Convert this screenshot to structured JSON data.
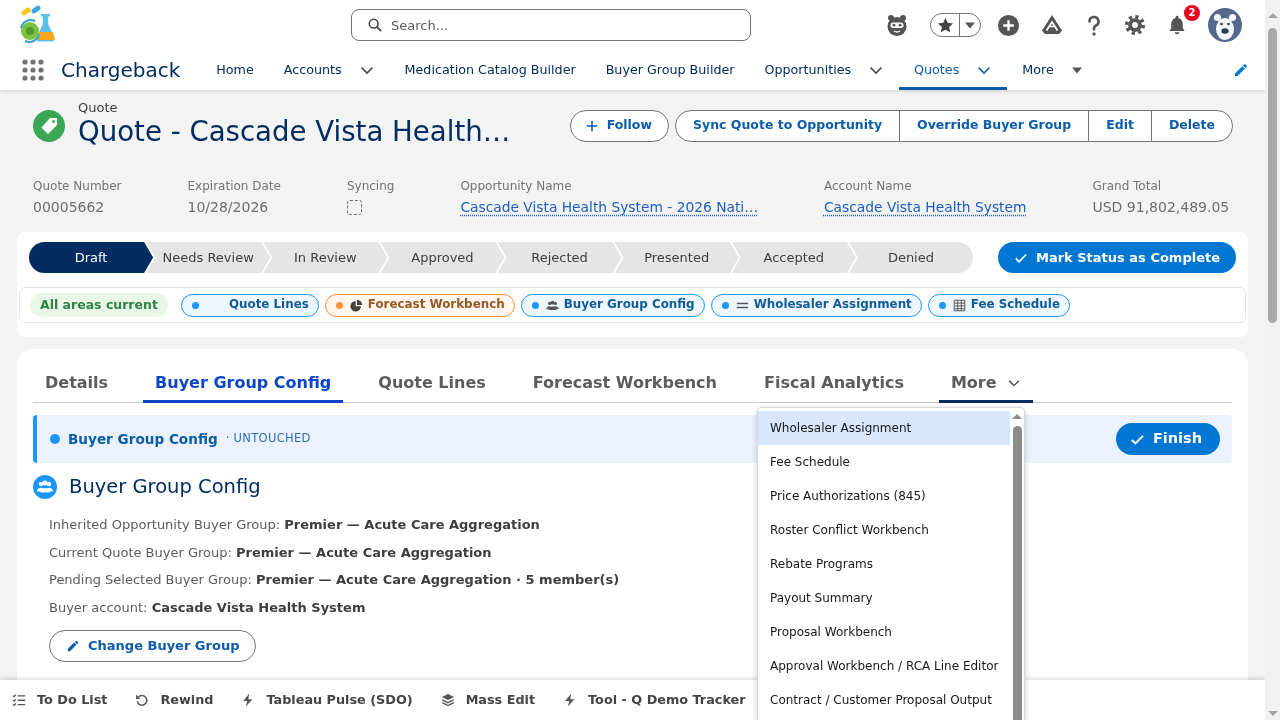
{
  "header": {
    "search": {
      "placeholder": "Search..."
    },
    "notification_count": "2"
  },
  "nav": {
    "app_name": "Chargeback",
    "items": [
      {
        "label": "Home",
        "kind": "link",
        "selected": false
      },
      {
        "label": "Accounts",
        "kind": "dropdown",
        "selected": false
      },
      {
        "label": "Medication Catalog Builder",
        "kind": "link",
        "selected": false
      },
      {
        "label": "Buyer Group Builder",
        "kind": "link",
        "selected": false
      },
      {
        "label": "Opportunities",
        "kind": "dropdown",
        "selected": false
      },
      {
        "label": "Quotes",
        "kind": "dropdown",
        "selected": true
      },
      {
        "label": "More",
        "kind": "overflow",
        "selected": false
      }
    ]
  },
  "record": {
    "object_label": "Quote",
    "title": "Quote - Cascade Vista Health…",
    "follow_button": "Follow",
    "actions": [
      "Sync Quote to Opportunity",
      "Override Buyer Group",
      "Edit",
      "Delete"
    ],
    "fields": [
      {
        "label": "Quote Number",
        "kind": "text",
        "value": "00005662"
      },
      {
        "label": "Expiration Date",
        "kind": "text",
        "value": "10/28/2026"
      },
      {
        "label": "Syncing",
        "kind": "checkbox",
        "checked": false
      },
      {
        "label": "Opportunity Name",
        "kind": "link",
        "value": "Cascade Vista Health System - 2026 Nati…"
      },
      {
        "label": "Account Name",
        "kind": "link",
        "value": "Cascade Vista Health System"
      },
      {
        "label": "Grand Total",
        "kind": "text",
        "value": "USD 91,802,489.05"
      }
    ]
  },
  "path": {
    "stages": [
      {
        "label": "Draft",
        "selected": true
      },
      {
        "label": "Needs Review",
        "selected": false
      },
      {
        "label": "In Review",
        "selected": false
      },
      {
        "label": "Approved",
        "selected": false
      },
      {
        "label": "Rejected",
        "selected": false
      },
      {
        "label": "Presented",
        "selected": false
      },
      {
        "label": "Accepted",
        "selected": false
      },
      {
        "label": "Denied",
        "selected": false
      }
    ],
    "complete_button": "Mark Status as Complete"
  },
  "areas": {
    "summary": "All areas current",
    "chips": [
      {
        "label": "Quote Lines",
        "kind": "plain",
        "color": "#1b96ff"
      },
      {
        "label": "Forecast Workbench",
        "kind": "chart",
        "color": "#fe9339"
      },
      {
        "label": "Buyer Group Config",
        "kind": "group",
        "color": "#1b96ff"
      },
      {
        "label": "Wholesaler Assignment",
        "kind": "list",
        "color": "#1b96ff"
      },
      {
        "label": "Fee Schedule",
        "kind": "table",
        "color": "#1b96ff"
      }
    ]
  },
  "tabs": {
    "items": [
      {
        "label": "Details",
        "selected": false
      },
      {
        "label": "Buyer Group Config",
        "selected": true
      },
      {
        "label": "Quote Lines",
        "selected": false
      },
      {
        "label": "Forecast Workbench",
        "selected": false
      },
      {
        "label": "Fiscal Analytics",
        "selected": false
      }
    ],
    "more": {
      "label": "More",
      "expanded": true
    }
  },
  "more_menu": {
    "items": [
      {
        "label": "Wholesaler Assignment",
        "selected": true
      },
      {
        "label": "Fee Schedule",
        "selected": false
      },
      {
        "label": "Price Authorizations (845)",
        "selected": false
      },
      {
        "label": "Roster Conflict Workbench",
        "selected": false
      },
      {
        "label": "Rebate Programs",
        "selected": false
      },
      {
        "label": "Payout Summary",
        "selected": false
      },
      {
        "label": "Proposal Workbench",
        "selected": false
      },
      {
        "label": "Approval Workbench / RCA Line Editor",
        "selected": false
      },
      {
        "label": "Contract / Customer Proposal Output",
        "selected": false
      }
    ]
  },
  "banner": {
    "title": "Buyer Group Config",
    "status": "· UNTOUCHED",
    "finish_button": "Finish"
  },
  "section": {
    "title": "Buyer Group Config",
    "lines": [
      "Inherited Opportunity Buyer Group: **Premier — Acute Care Aggregation**",
      "Current Quote Buyer Group: **Premier — Acute Care Aggregation**",
      "Pending Selected Buyer Group: **Premier — Acute Care Aggregation · 5 member(s)**",
      "Buyer account: **Cascade Vista Health System**"
    ],
    "change_button": "Change Buyer Group"
  },
  "utility_bar": {
    "items": [
      {
        "label": "To Do List",
        "kind": "todo"
      },
      {
        "label": "Rewind",
        "kind": "rewind"
      },
      {
        "label": "Tableau Pulse (SDO)",
        "kind": "bolt"
      },
      {
        "label": "Mass Edit",
        "kind": "layers"
      },
      {
        "label": "Tool - Q Demo Tracker",
        "kind": "bolt"
      }
    ]
  }
}
